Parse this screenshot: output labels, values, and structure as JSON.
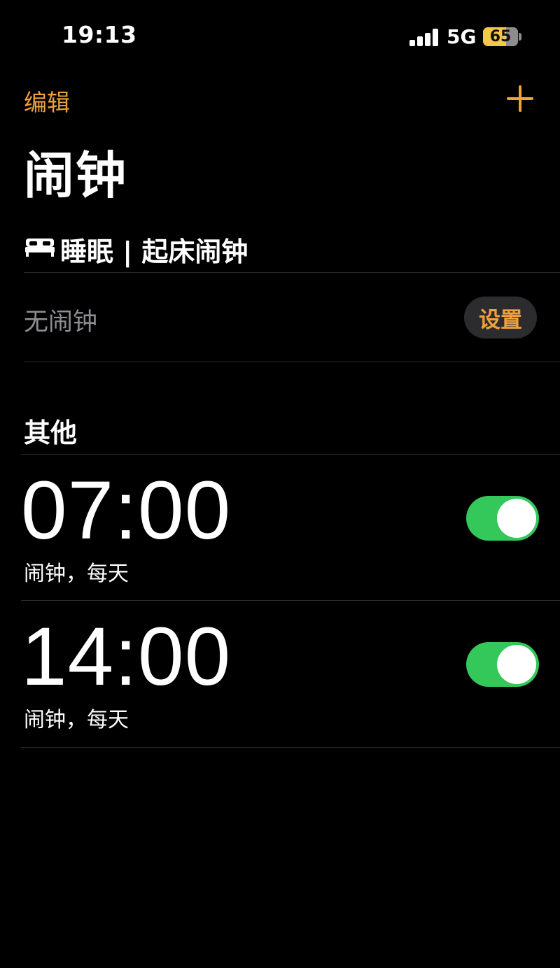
{
  "status_bar": {
    "time": "19:13",
    "network": "5G",
    "battery": "65",
    "battery_color": "#f6c84a"
  },
  "nav": {
    "edit_label": "编辑",
    "add_icon": "plus-icon",
    "accent_color": "#f0a23a"
  },
  "title": "闹钟",
  "sleep": {
    "icon": "bed-icon",
    "title": "睡眠 | 起床闹钟",
    "no_alarm": "无闹钟",
    "setup_label": "设置"
  },
  "others": {
    "title": "其他",
    "alarms": [
      {
        "time": "07:00",
        "label": "闹钟，每天",
        "enabled": true
      },
      {
        "time": "14:00",
        "label": "闹钟，每天",
        "enabled": true
      }
    ],
    "toggle_on_color": "#34c759"
  }
}
